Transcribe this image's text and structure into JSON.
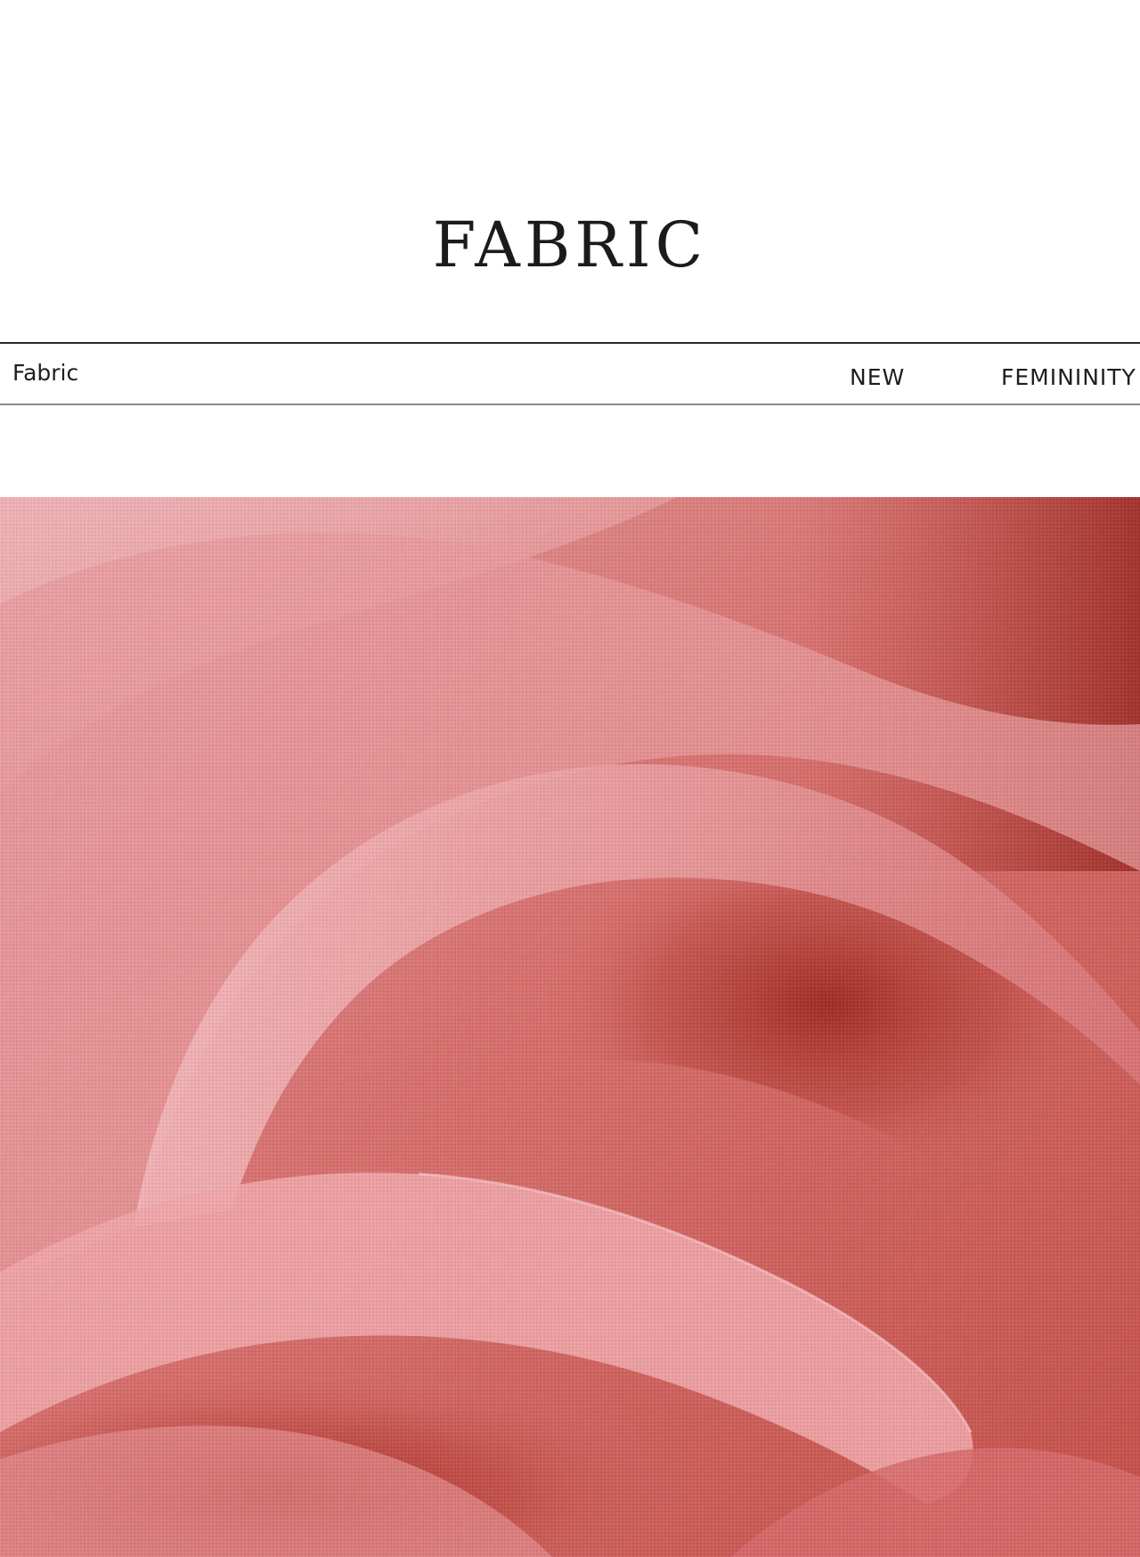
{
  "hero": {
    "title": "FABRIC"
  },
  "nav": {
    "left_label": "Fabric",
    "mid_label": "NEW",
    "right_label": "FEMININITY"
  },
  "photo": {
    "subject": "pink-linen-fabric-photo",
    "colors": {
      "base": "#d9777a",
      "highlight": "#efb0b2",
      "shadow": "#a6302a",
      "deep_shadow": "#8c211b"
    }
  },
  "colors": {
    "text": "#1b1b1b",
    "rule_top": "#2a2a2a",
    "rule_bottom": "#8a8a8a",
    "background": "#ffffff"
  }
}
